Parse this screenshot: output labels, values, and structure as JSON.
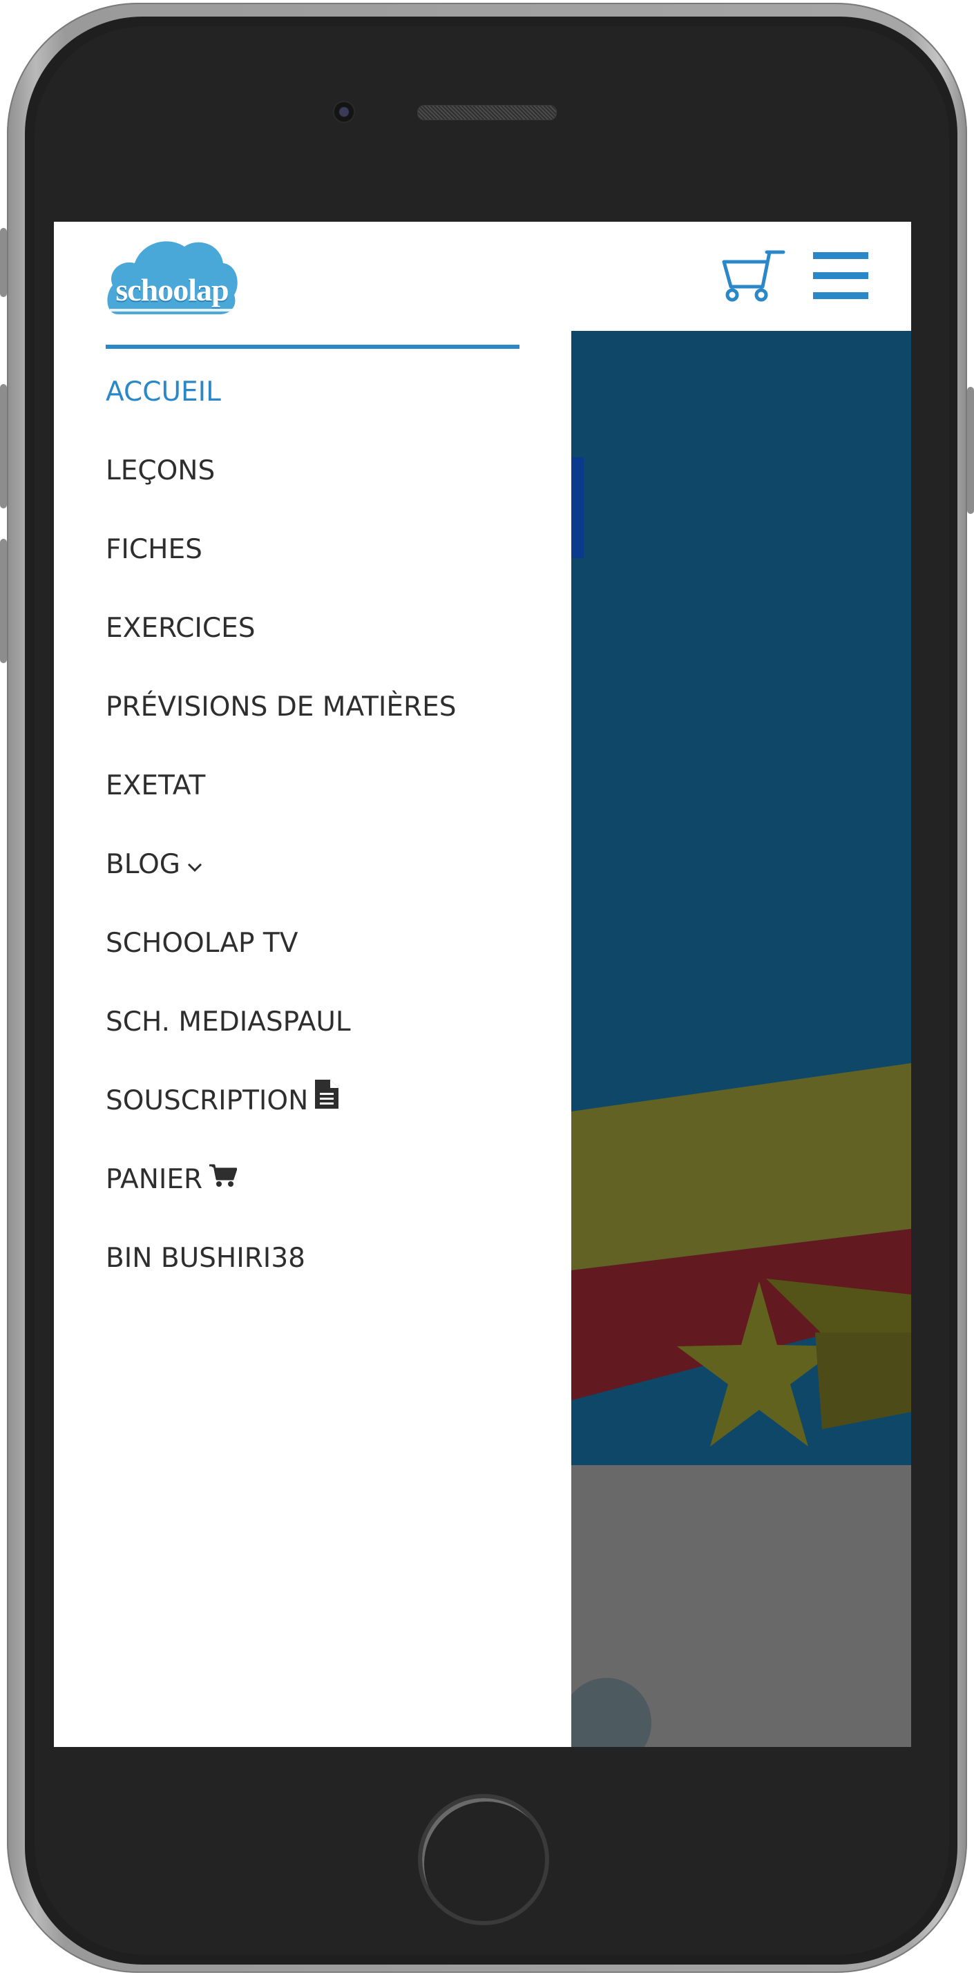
{
  "brand": {
    "logo_text": "schoolap",
    "accent_color": "#2b88c8",
    "logo_cloud_color": "#4aa8d8"
  },
  "header": {
    "cart_icon": "shopping-cart-icon",
    "menu_icon": "hamburger-menu-icon"
  },
  "menu": {
    "items": [
      {
        "label": "ACCUEIL",
        "active": true
      },
      {
        "label": "LEÇONS"
      },
      {
        "label": "FICHES"
      },
      {
        "label": "EXERCICES"
      },
      {
        "label": "PRÉVISIONS DE MATIÈRES"
      },
      {
        "label": "EXETAT"
      },
      {
        "label": "BLOG",
        "icon": "chevron-down-icon"
      },
      {
        "label": "SCHOOLAP TV"
      },
      {
        "label": "SCH. MEDIASPAUL"
      },
      {
        "label": "SOUSCRIPTION",
        "icon": "document-icon"
      },
      {
        "label": "PANIER",
        "icon": "shopping-cart-icon"
      },
      {
        "label": "BIN BUSHIRI38"
      }
    ]
  },
  "colors": {
    "hero_blue": "#0f4768",
    "flag_yellow": "#626224",
    "flag_red": "#62191f",
    "overlay_gray": "#696969"
  }
}
